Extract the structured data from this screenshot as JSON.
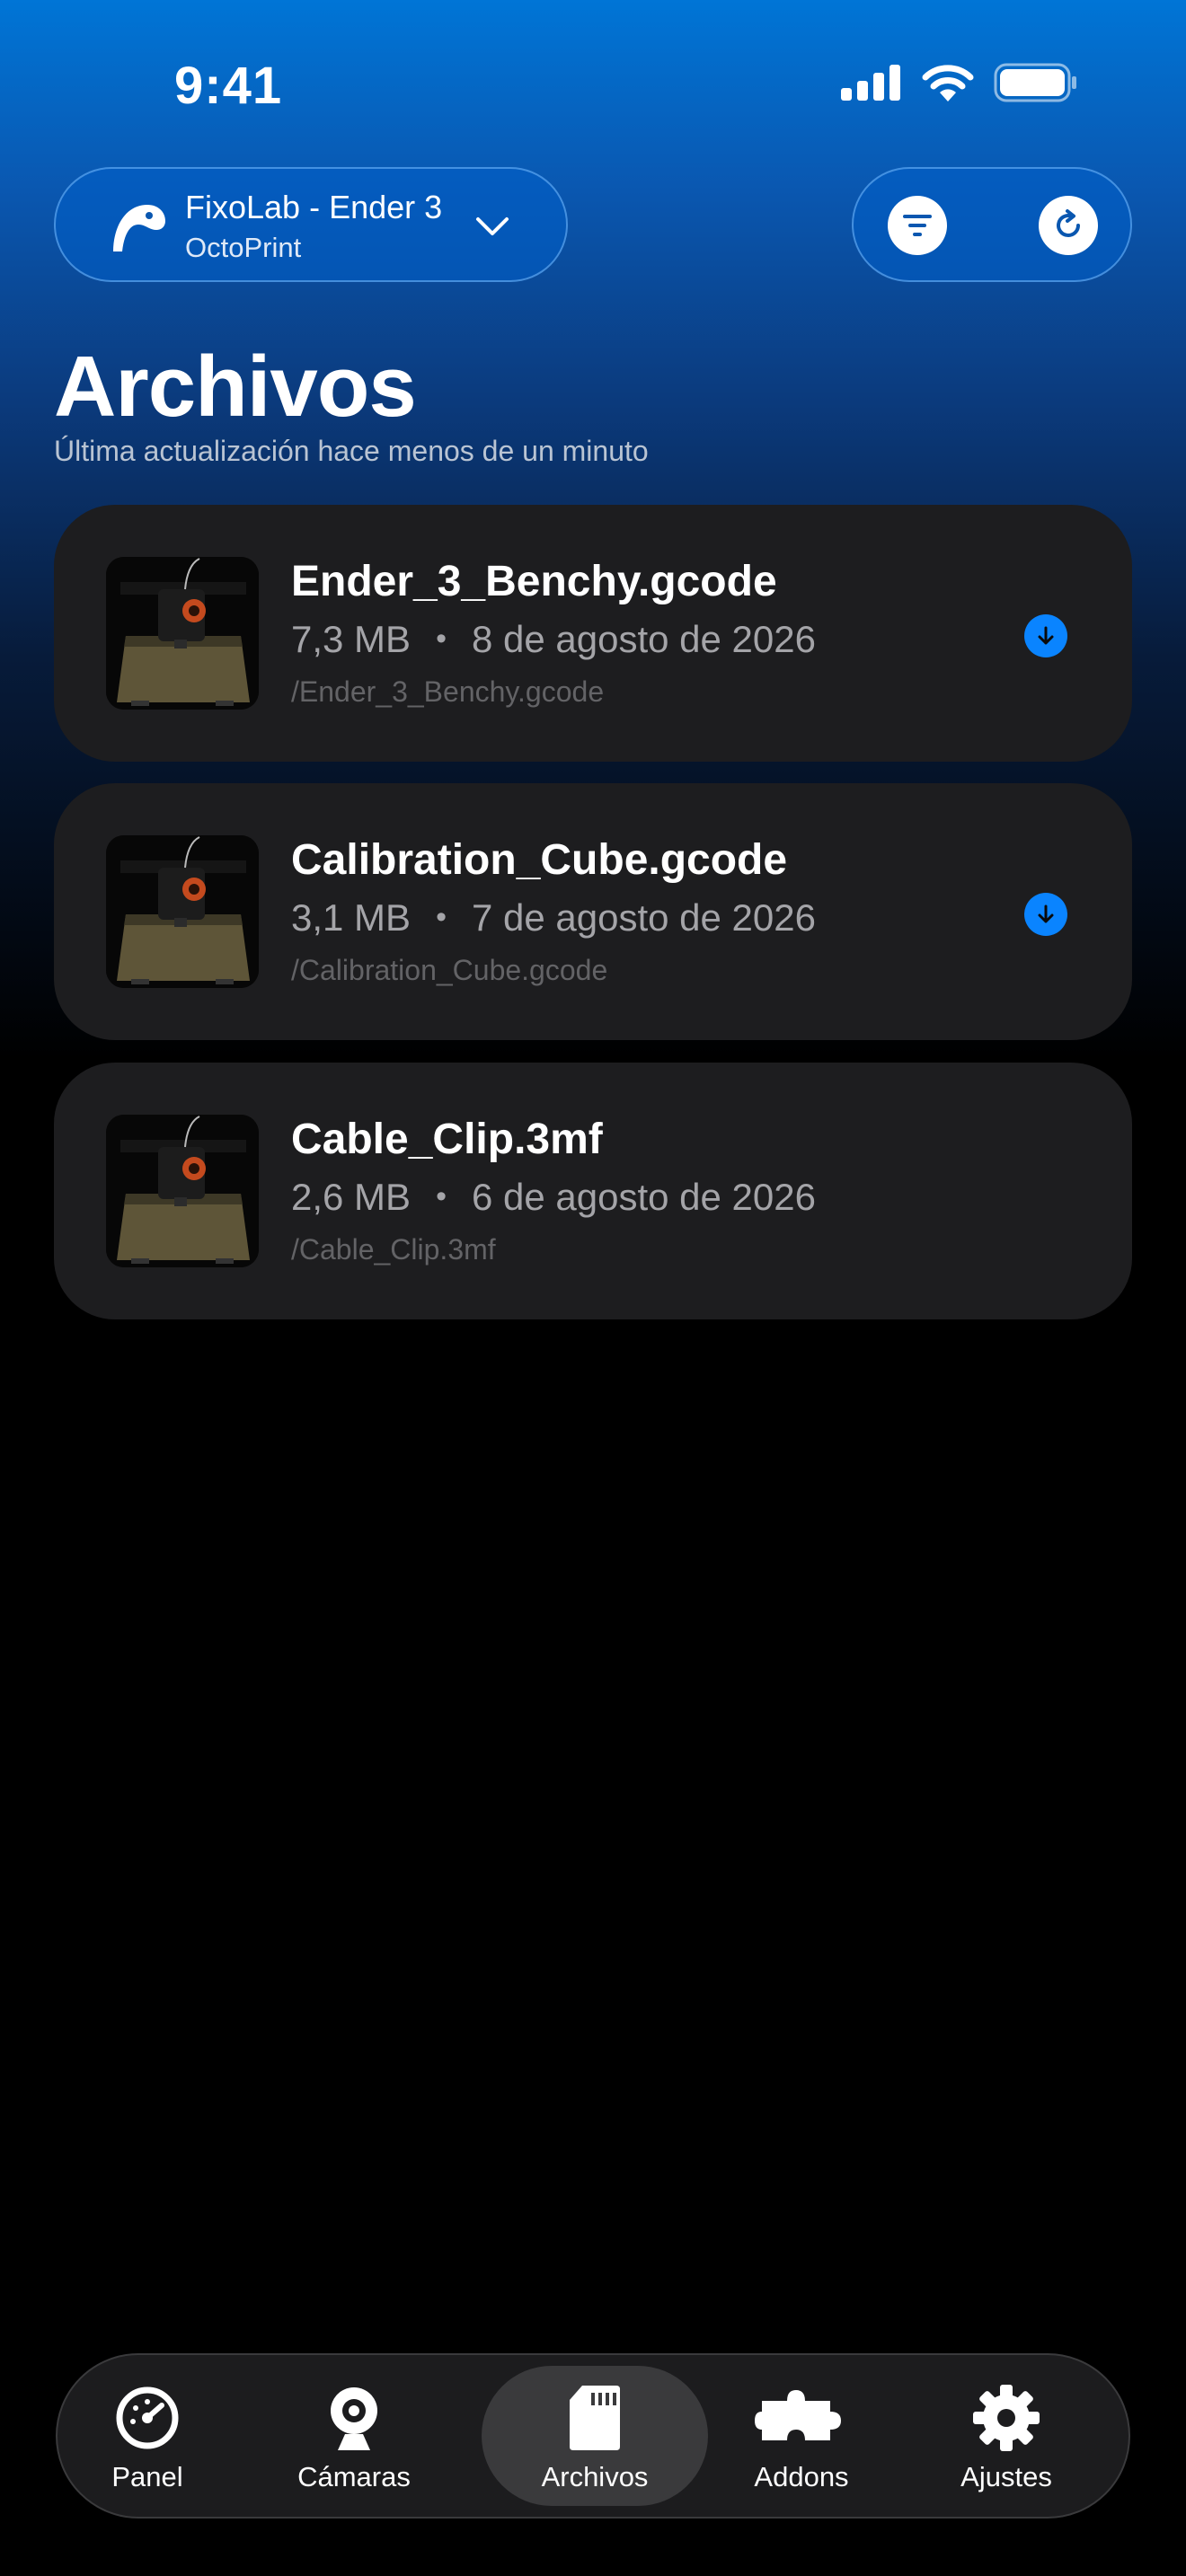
{
  "status_bar": {
    "time": "9:41"
  },
  "header": {
    "printer_name": "FixoLab - Ender 3",
    "printer_software": "OctoPrint"
  },
  "page": {
    "title": "Archivos",
    "subtitle": "Última actualización hace menos de un minuto"
  },
  "files": [
    {
      "name": "Ender_3_Benchy.gcode",
      "size": "7,3 MB",
      "date": "8 de agosto de 2026",
      "path": "/Ender_3_Benchy.gcode",
      "downloadable": true
    },
    {
      "name": "Calibration_Cube.gcode",
      "size": "3,1 MB",
      "date": "7 de agosto de 2026",
      "path": "/Calibration_Cube.gcode",
      "downloadable": true
    },
    {
      "name": "Cable_Clip.3mf",
      "size": "2,6 MB",
      "date": "6 de agosto de 2026",
      "path": "/Cable_Clip.3mf",
      "downloadable": false
    }
  ],
  "meta_separator": "•",
  "tab_bar": {
    "active": "Archivos",
    "tabs": [
      {
        "label": "Panel",
        "icon": "gauge-icon"
      },
      {
        "label": "Cámaras",
        "icon": "webcam-icon"
      },
      {
        "label": "Archivos",
        "icon": "sd-card-icon"
      },
      {
        "label": "Addons",
        "icon": "puzzle-icon"
      },
      {
        "label": "Ajustes",
        "icon": "gear-icon"
      }
    ]
  },
  "colors": {
    "accent": "#0a84ff",
    "card_background": "#1d1d1f",
    "header_gradient_top": "#0075d6"
  }
}
